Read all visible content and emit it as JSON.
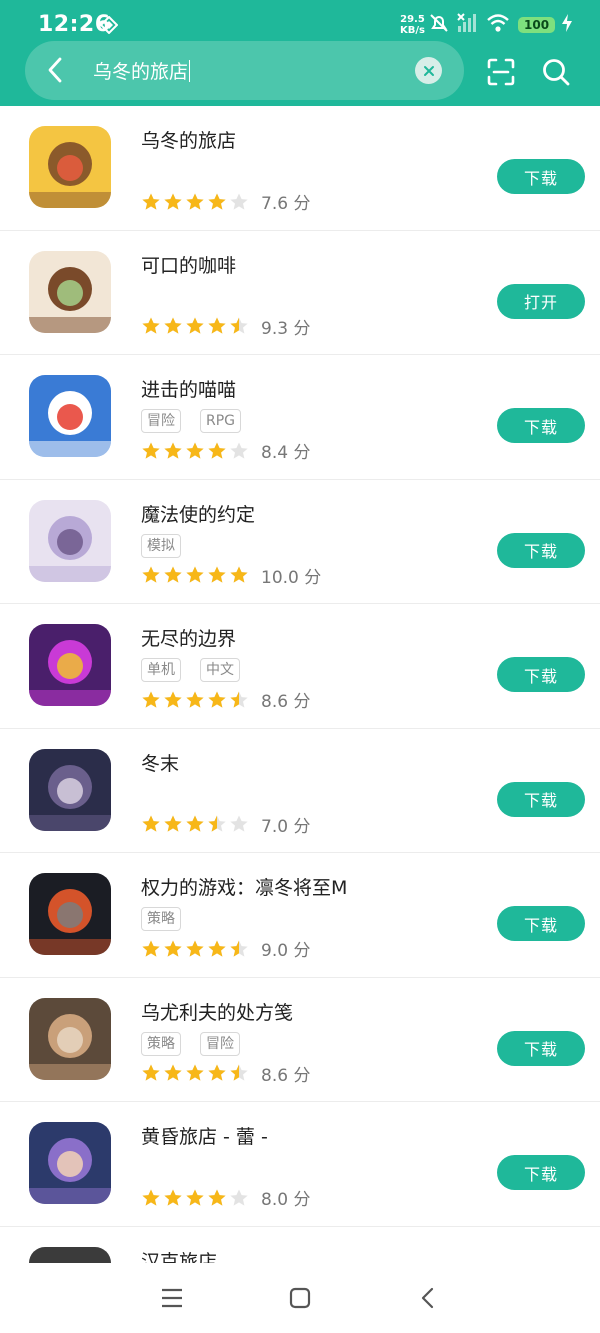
{
  "status_bar": {
    "time": "12:26",
    "speed_value": "29.5",
    "speed_unit": "KB/s",
    "battery": "100"
  },
  "search": {
    "query": "乌冬的旅店"
  },
  "apps": [
    {
      "name": "乌冬的旅店",
      "tags": [],
      "rating": 4,
      "score": "7.6 分",
      "action": "下载"
    },
    {
      "name": "可口的咖啡",
      "tags": [],
      "rating": 4.5,
      "score": "9.3 分",
      "action": "打开"
    },
    {
      "name": "进击的喵喵",
      "tags": [
        "冒险",
        "RPG"
      ],
      "rating": 4,
      "score": "8.4 分",
      "action": "下载"
    },
    {
      "name": "魔法使的约定",
      "tags": [
        "模拟"
      ],
      "rating": 5,
      "score": "10.0 分",
      "action": "下载"
    },
    {
      "name": "无尽的边界",
      "tags": [
        "单机",
        "中文"
      ],
      "rating": 4.5,
      "score": "8.6 分",
      "action": "下载"
    },
    {
      "name": "冬末",
      "tags": [],
      "rating": 3.5,
      "score": "7.0 分",
      "action": "下载"
    },
    {
      "name": "权力的游戏：凛冬将至M",
      "tags": [
        "策略"
      ],
      "rating": 4.5,
      "score": "9.0 分",
      "action": "下载"
    },
    {
      "name": "乌尤利夫的处方笺",
      "tags": [
        "策略",
        "冒险"
      ],
      "rating": 4.5,
      "score": "8.6 分",
      "action": "下载"
    },
    {
      "name": "黄昏旅店 - 蕾 -",
      "tags": [],
      "rating": 4,
      "score": "8.0 分",
      "action": "下载"
    },
    {
      "name": "汉克旅店",
      "tags": [],
      "rating": 0,
      "score": "",
      "action": ""
    }
  ],
  "colors": {
    "accent": "#1fb89a",
    "star": "#f7b718",
    "star_empty": "#e3e3e3"
  }
}
